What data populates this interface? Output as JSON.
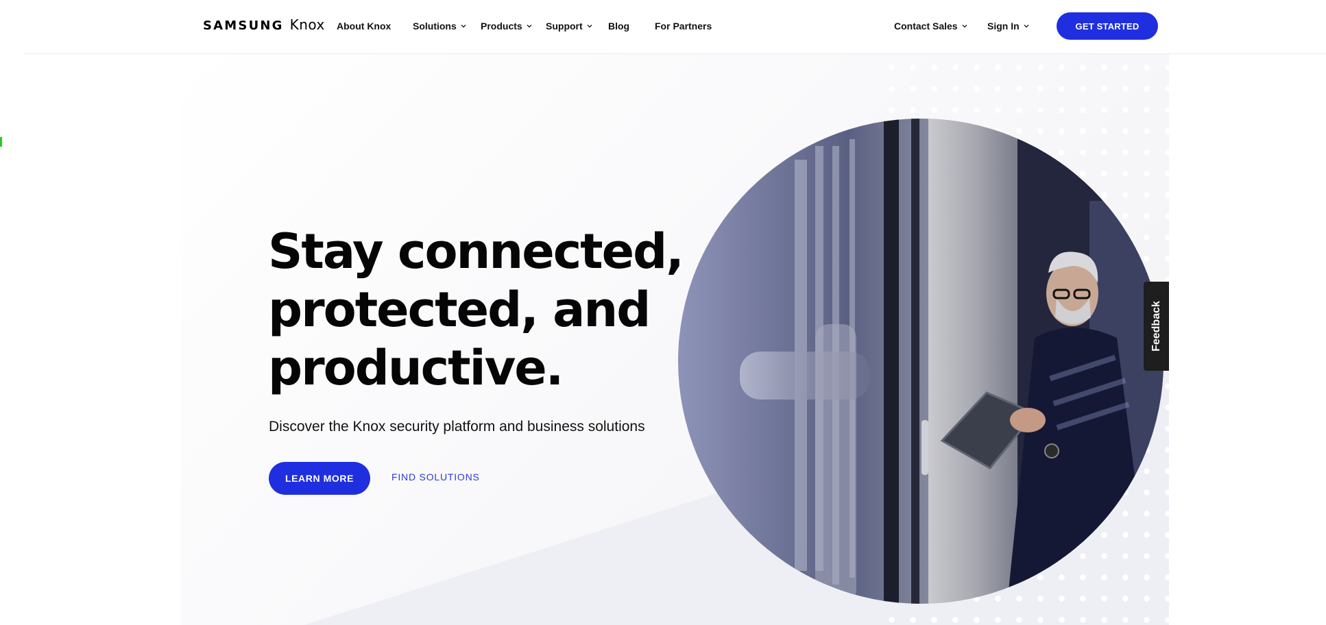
{
  "brand": {
    "samsung": "SAMSUNG",
    "knox": "Knox"
  },
  "nav": {
    "about": "About Knox",
    "solutions": "Solutions",
    "products": "Products",
    "support": "Support",
    "blog": "Blog",
    "partners": "For Partners",
    "contact_sales": "Contact Sales",
    "sign_in": "Sign In",
    "get_started": "GET STARTED"
  },
  "hero": {
    "headline": "Stay connected, protected, and productive.",
    "subline": "Discover the Knox security platform and business solutions",
    "learn_more": "LEARN MORE",
    "find_solutions": "FIND SOLUTIONS"
  },
  "feedback": "Feedback",
  "colors": {
    "accent": "#1f2fdf",
    "link": "#2b3ad8",
    "feedback_bg": "#1e1e1e"
  },
  "icons": {
    "dropdown": "chevron-down-icon"
  }
}
